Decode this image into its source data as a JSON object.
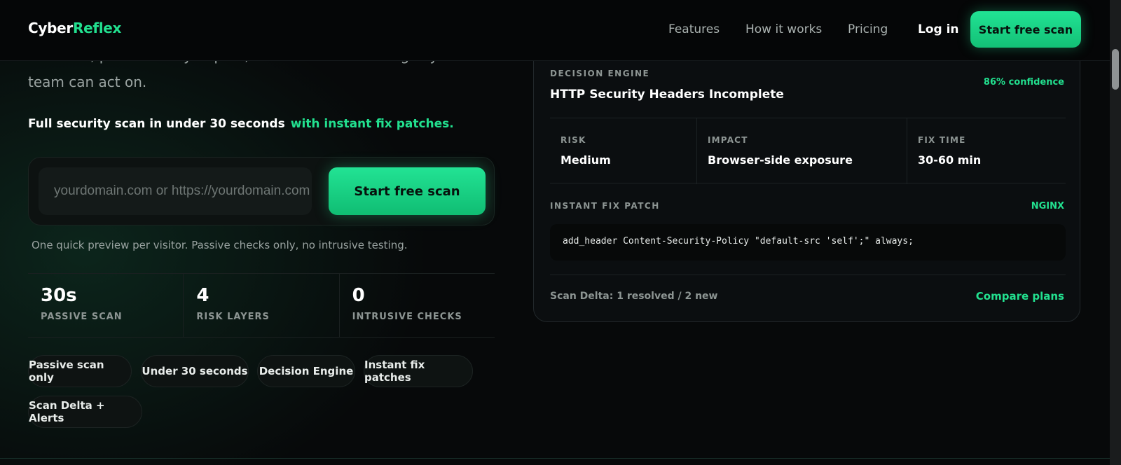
{
  "header": {
    "logo_part1": "Cyber",
    "logo_part2": "Reflex",
    "nav": [
      "Features",
      "How it works",
      "Pricing"
    ],
    "login": "Log in",
    "cta": "Start free scan"
  },
  "hero": {
    "description_line1": "detected, prioritized by impact, and turned into changes your",
    "description_line2": "team can act on.",
    "subtitle": "Full security scan in under 30 seconds",
    "subtitle_accent": "with instant fix patches.",
    "input_placeholder": "yourdomain.com or https://yourdomain.com",
    "scan_button": "Start free scan",
    "note": "One quick preview per visitor. Passive checks only, no intrusive testing."
  },
  "stats": [
    {
      "value": "30s",
      "label": "PASSIVE SCAN"
    },
    {
      "value": "4",
      "label": "RISK LAYERS"
    },
    {
      "value": "0",
      "label": "INTRUSIVE CHECKS"
    }
  ],
  "chips": [
    "Passive scan only",
    "Under 30 seconds",
    "Decision Engine",
    "Instant fix patches",
    "Scan Delta + Alerts"
  ],
  "card": {
    "eyebrow": "DECISION ENGINE",
    "title": "HTTP Security Headers Incomplete",
    "confidence": "86% confidence",
    "metrics": [
      {
        "label": "RISK",
        "value": "Medium"
      },
      {
        "label": "IMPACT",
        "value": "Browser-side exposure"
      },
      {
        "label": "FIX TIME",
        "value": "30-60 min"
      }
    ],
    "patch_label": "INSTANT FIX PATCH",
    "patch_lang": "NGINX",
    "patch_code": "add_header Content-Security-Policy \"default-src 'self';\" always;",
    "delta": "Scan Delta: 1 resolved / 2 new",
    "compare": "Compare plans"
  },
  "colors": {
    "accent": "#22e08f",
    "background": "#07090a",
    "card": "#0b0e10"
  }
}
